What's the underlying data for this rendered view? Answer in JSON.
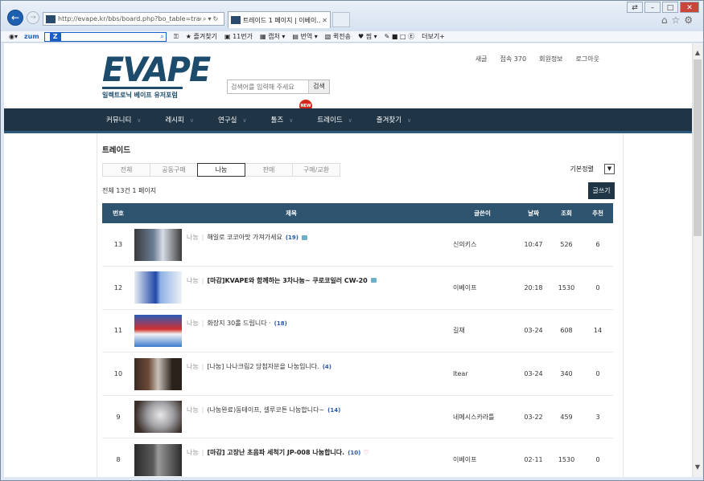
{
  "browser": {
    "url": "http://evape.kr/bbs/board.php?bo_table=trade&sc",
    "tab_title": "트레이드 1 페이지 | 이베이...",
    "toolbar_items": [
      "zum",
      "즐겨찾기",
      "11번가",
      "캡처",
      "번역",
      "퀵전송",
      "찜",
      "더보기+"
    ]
  },
  "site": {
    "logo_text": "EVAPE",
    "logo_sub": "일렉트로닉 베이프 유저포럼",
    "search_placeholder": "검색어를 입력해 주세요",
    "search_button": "검색",
    "top_links": [
      "새글",
      "접속 370",
      "회원정보",
      "로그아웃"
    ],
    "new_badge": "NEW",
    "menu": [
      "커뮤니티",
      "레시피",
      "연구실",
      "툴즈",
      "트레이드",
      "즐겨찾기"
    ]
  },
  "board": {
    "title": "트레이드",
    "categories": [
      "전체",
      "공동구매",
      "나눔",
      "판매",
      "구매/교환"
    ],
    "active_category": "나눔",
    "sort_label": "기본정렬",
    "total_text": "전체 13건 1 페이지",
    "write_button": "글쓰기",
    "columns": [
      "번호",
      "제목",
      "글쓴이",
      "날짜",
      "조회",
      "추천"
    ],
    "rows": [
      {
        "no": "13",
        "cat": "나눔",
        "title": "해일로 코코아맛 가져가세요",
        "count": "(19)",
        "bold": false,
        "icon": "bubble",
        "author": "신의키스",
        "date": "10:47",
        "views": "526",
        "rec": "6",
        "thumb": "t1"
      },
      {
        "no": "12",
        "cat": "나눔",
        "title": "[마감]KVAPE와 함께하는 3차나눔~ 쿠로코일러 CW-20",
        "count": "",
        "bold": true,
        "icon": "bubble",
        "author": "이베이프",
        "date": "20:18",
        "views": "1530",
        "rec": "0",
        "thumb": "t2"
      },
      {
        "no": "11",
        "cat": "나눔",
        "title": "화장지 30롤 드립니다 ·",
        "count": "(18)",
        "bold": false,
        "icon": "",
        "author": "길채",
        "date": "03-24",
        "views": "608",
        "rec": "14",
        "thumb": "t3"
      },
      {
        "no": "10",
        "cat": "나눔",
        "title": "[나눔] 나나크림2 당첨자분을 나눔입니다.",
        "count": "(4)",
        "bold": false,
        "icon": "",
        "author": "Itear",
        "date": "03-24",
        "views": "340",
        "rec": "0",
        "thumb": "t4"
      },
      {
        "no": "9",
        "cat": "나눔",
        "title": "(나눔완료)동테이프, 셀루코튼 나눔합니다~",
        "count": "(14)",
        "bold": false,
        "icon": "",
        "author": "네메시스카라틀",
        "date": "03-22",
        "views": "459",
        "rec": "3",
        "thumb": "t5"
      },
      {
        "no": "8",
        "cat": "나눔",
        "title": "[마감] 고장난 초음파 세척기 JP-008 나눔합니다.",
        "count": "(10)",
        "bold": true,
        "icon": "heart",
        "author": "이베이프",
        "date": "02-11",
        "views": "1530",
        "rec": "0",
        "thumb": "t6"
      }
    ]
  }
}
